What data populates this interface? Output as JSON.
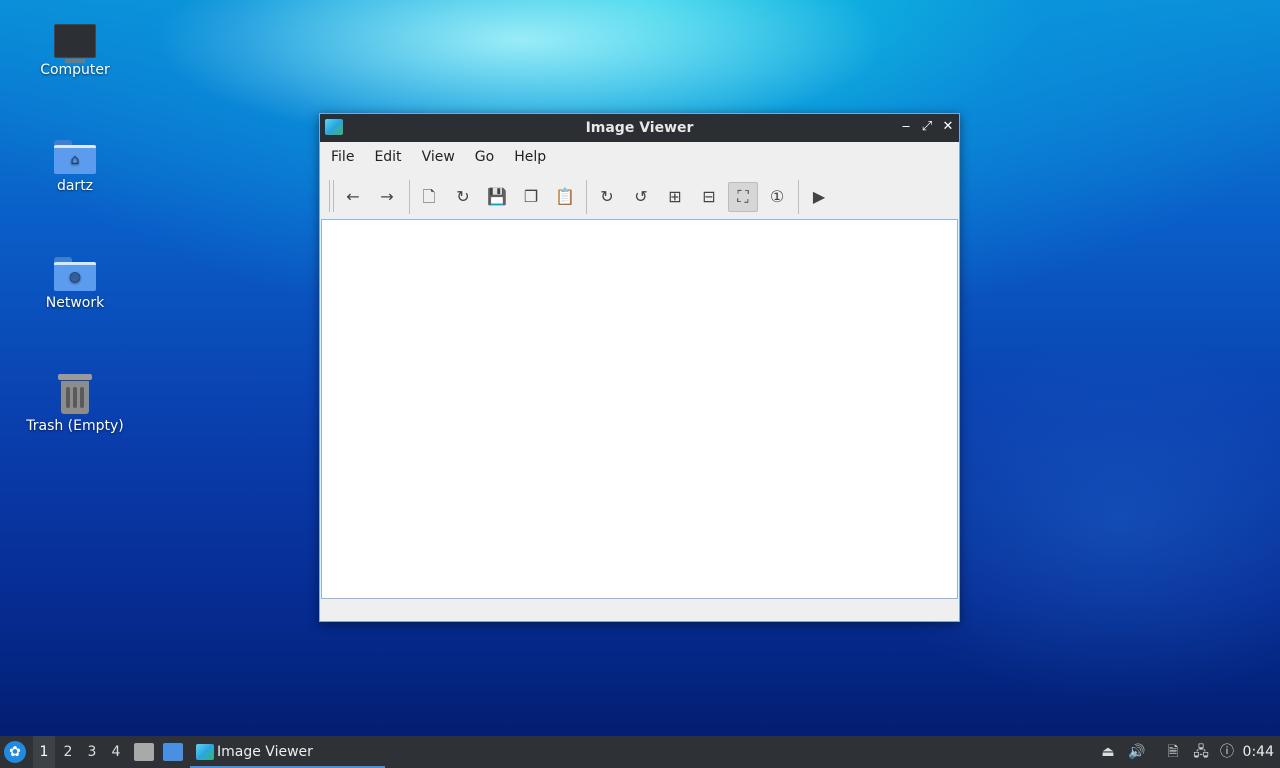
{
  "desktop": {
    "icons": [
      {
        "label": "Computer"
      },
      {
        "label": "dartz"
      },
      {
        "label": "Network"
      },
      {
        "label": "Trash (Empty)"
      }
    ]
  },
  "window": {
    "title": "Image Viewer",
    "menu": [
      "File",
      "Edit",
      "View",
      "Go",
      "Help"
    ],
    "toolbar": [
      "back-icon",
      "forward-icon",
      "open-file-icon",
      "reload-icon",
      "save-as-icon",
      "copy-icon",
      "paste-icon",
      "rotate-clockwise-icon",
      "rotate-counterclockwise-icon",
      "zoom-in-icon",
      "zoom-out-icon",
      "fit-to-window-icon",
      "original-size-icon",
      "slideshow-icon"
    ]
  },
  "taskbar": {
    "workspaces": [
      "1",
      "2",
      "3",
      "4"
    ],
    "task_label": "Image Viewer",
    "clock": "0:44"
  },
  "colors": {
    "titlebar": "#2b2e33",
    "taskbar": "#2e3136",
    "accent": "#4a90e2"
  }
}
